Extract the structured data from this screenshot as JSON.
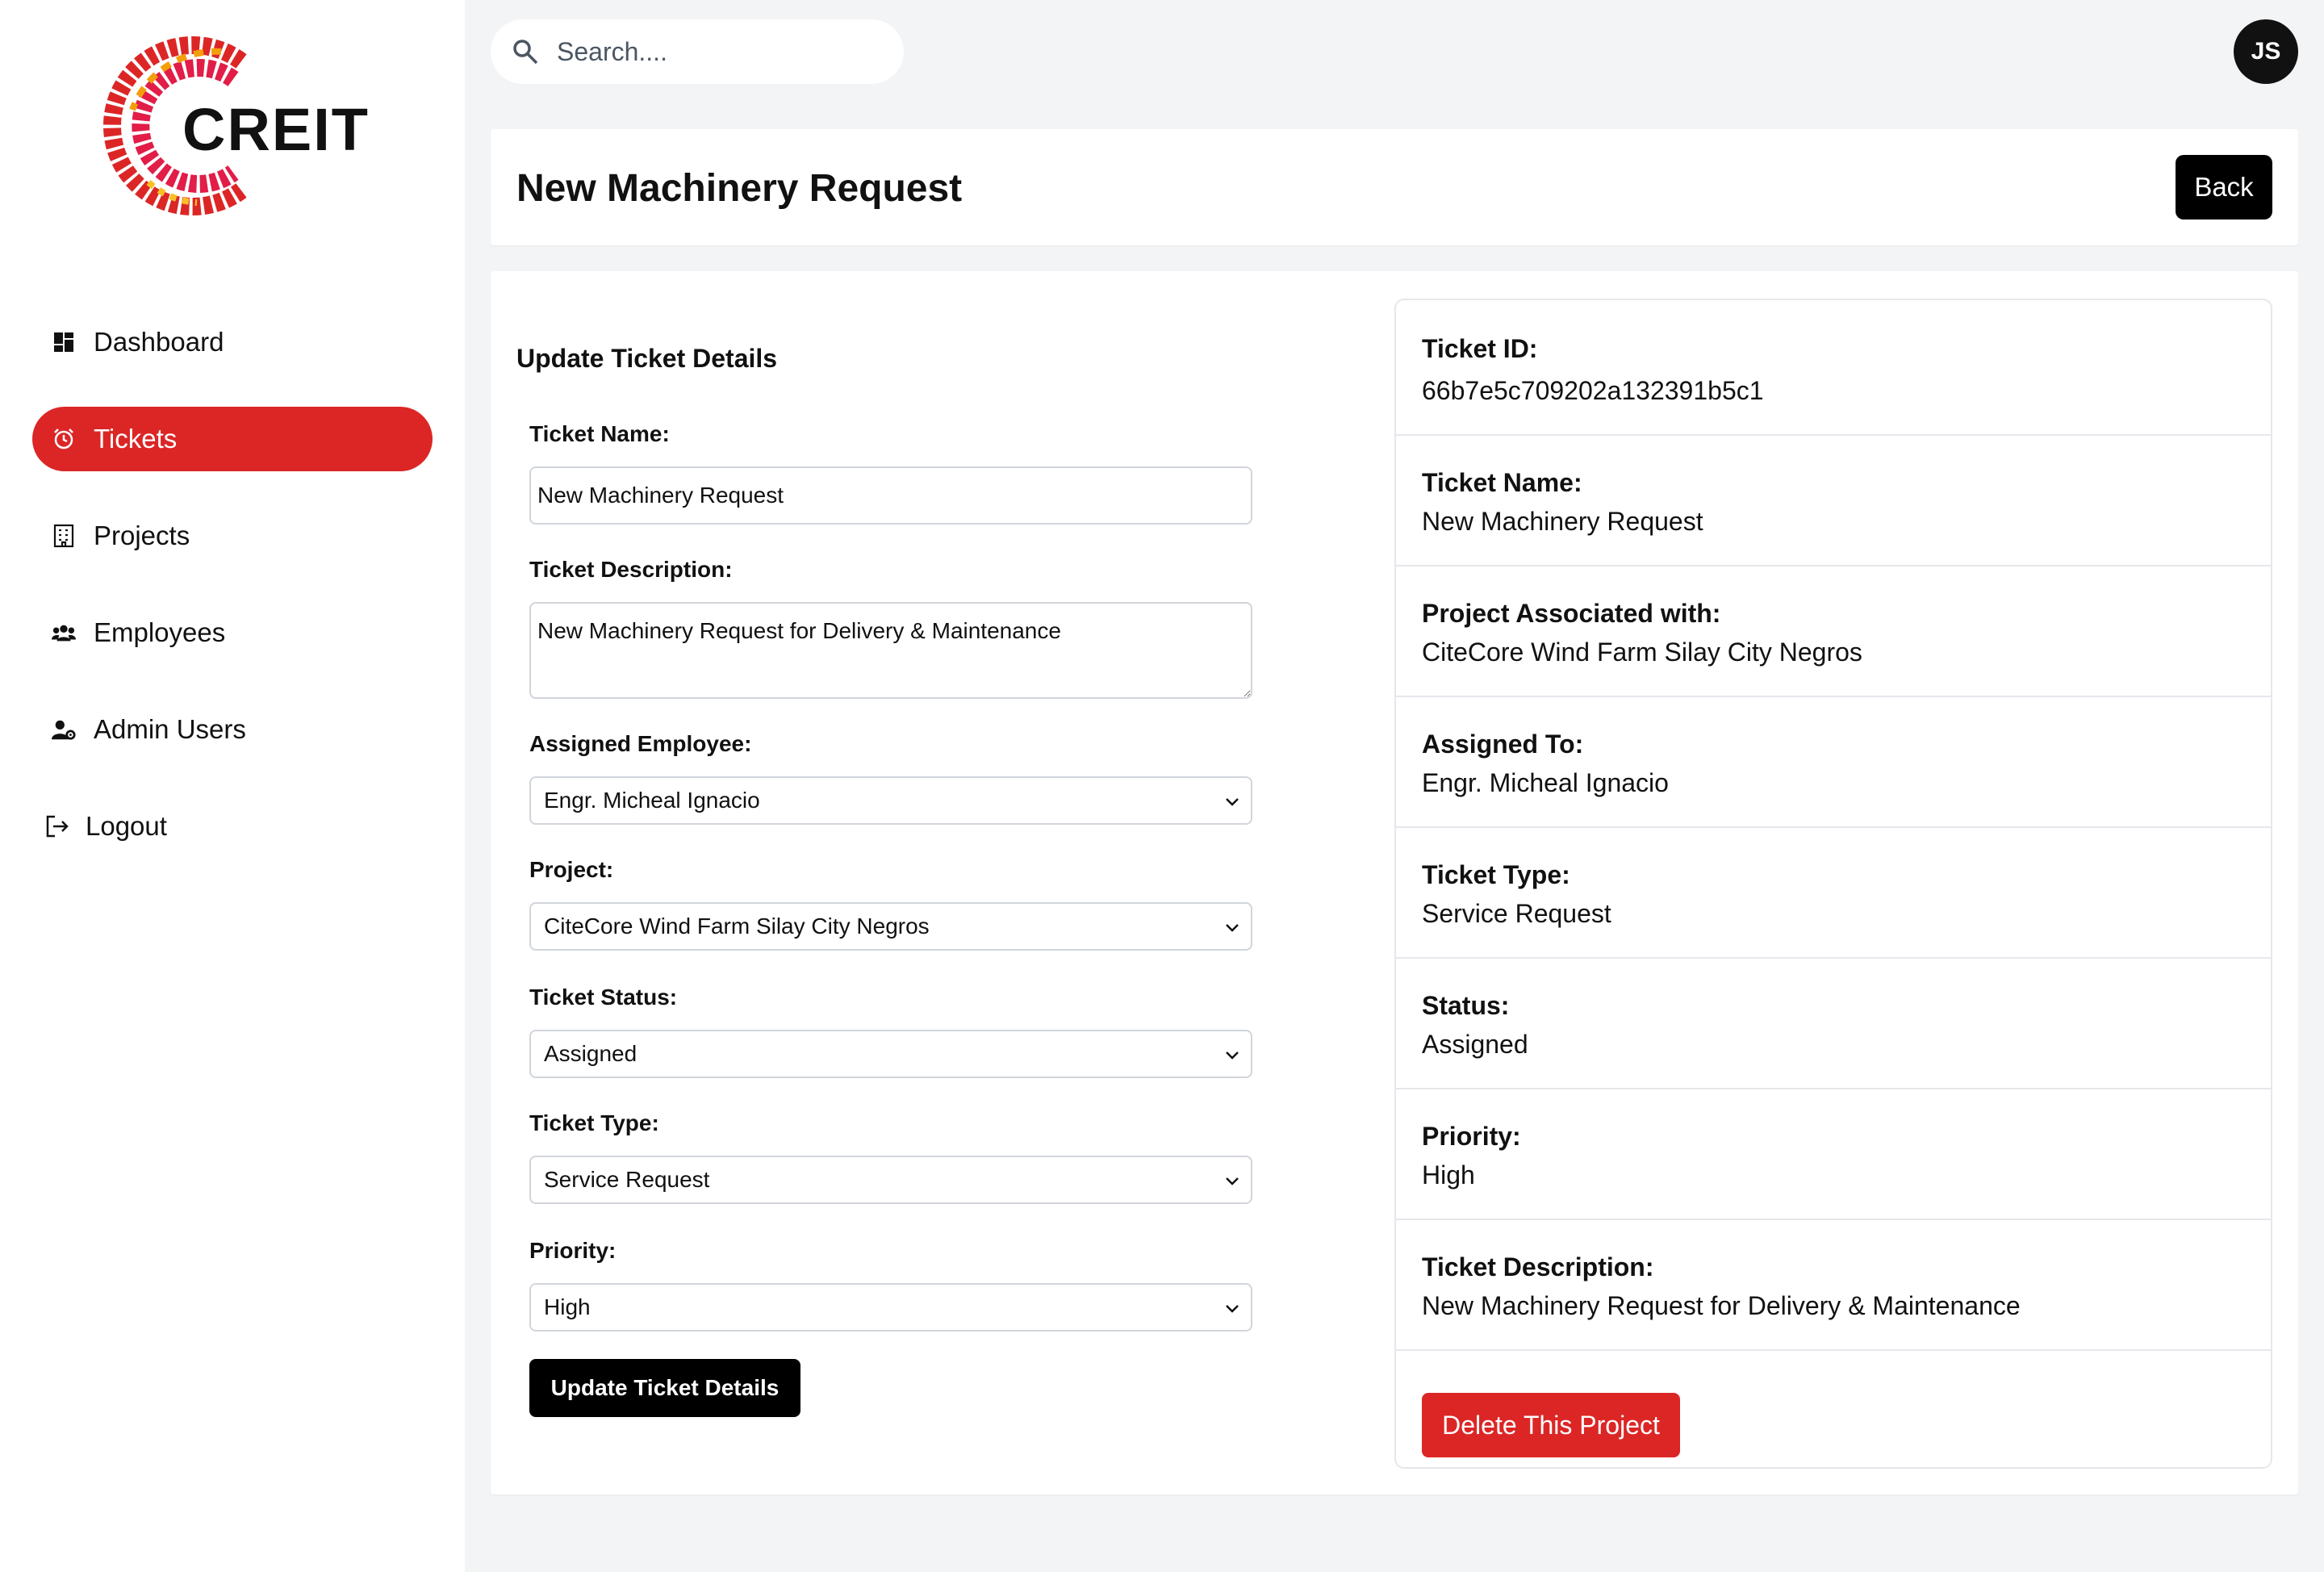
{
  "brand": {
    "name": "CREIT",
    "accent": "#dc2626"
  },
  "sidebar": {
    "items": [
      {
        "label": "Dashboard",
        "icon": "dashboard-icon",
        "active": false
      },
      {
        "label": "Tickets",
        "icon": "alarm-clock-icon",
        "active": true
      },
      {
        "label": "Projects",
        "icon": "building-icon",
        "active": false
      },
      {
        "label": "Employees",
        "icon": "users-icon",
        "active": false
      },
      {
        "label": "Admin Users",
        "icon": "user-gear-icon",
        "active": false
      },
      {
        "label": "Logout",
        "icon": "logout-icon",
        "active": false
      }
    ]
  },
  "topbar": {
    "search_placeholder": "Search....",
    "avatar_initials": "JS"
  },
  "header": {
    "title": "New Machinery Request",
    "back_label": "Back"
  },
  "form": {
    "title": "Update Ticket Details",
    "ticket_name_label": "Ticket Name:",
    "ticket_name_value": "New Machinery Request",
    "description_label": "Ticket Description:",
    "description_value": "New Machinery Request for Delivery & Maintenance",
    "employee_label": "Assigned Employee:",
    "employee_value": "Engr. Micheal Ignacio",
    "project_label": "Project:",
    "project_value": "CiteCore Wind Farm Silay City Negros",
    "status_label": "Ticket Status:",
    "status_value": "Assigned",
    "type_label": "Ticket Type:",
    "type_value": "Service Request",
    "priority_label": "Priority:",
    "priority_value": "High",
    "submit_label": "Update Ticket Details"
  },
  "details": {
    "rows": [
      {
        "label": "Ticket ID:",
        "value": "66b7e5c709202a132391b5c1"
      },
      {
        "label": "Ticket Name:",
        "value": "New Machinery Request"
      },
      {
        "label": "Project Associated with:",
        "value": "CiteCore Wind Farm Silay City Negros"
      },
      {
        "label": "Assigned To:",
        "value": "Engr. Micheal Ignacio"
      },
      {
        "label": "Ticket Type:",
        "value": "Service Request"
      },
      {
        "label": "Status:",
        "value": "Assigned"
      },
      {
        "label": "Priority:",
        "value": "High"
      },
      {
        "label": "Ticket Description:",
        "value": "New Machinery Request for Delivery & Maintenance"
      }
    ],
    "delete_label": "Delete This Project"
  }
}
